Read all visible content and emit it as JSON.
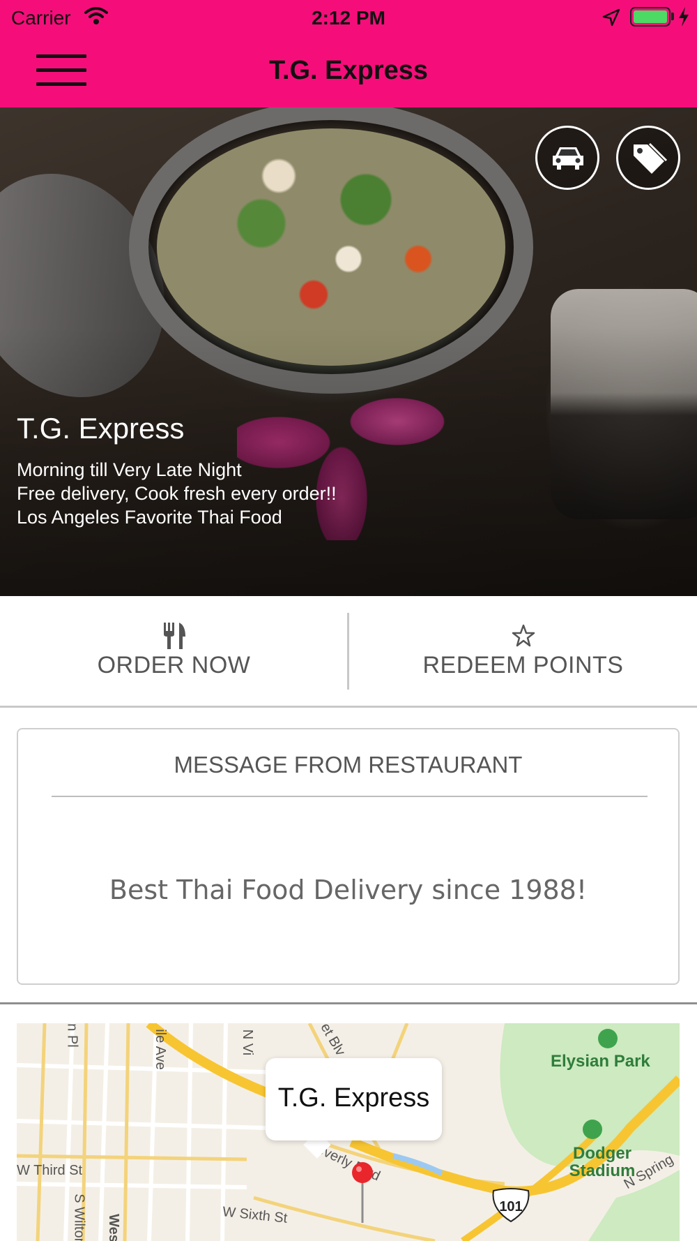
{
  "status_bar": {
    "carrier": "Carrier",
    "time": "2:12 PM"
  },
  "nav": {
    "title": "T.G. Express"
  },
  "hero": {
    "title": "T.G. Express",
    "lines": [
      "Morning till Very Late Night",
      "Free delivery, Cook fresh every order!!",
      "Los Angeles Favorite Thai Food"
    ]
  },
  "actions": {
    "order_label": "ORDER NOW",
    "redeem_label": "REDEEM POINTS"
  },
  "message": {
    "heading": "MESSAGE FROM RESTAURANT",
    "body": "Best Thai Food Delivery since 1988!"
  },
  "map": {
    "callout": "T.G. Express",
    "highway": "101",
    "park_labels": [
      "Elysian Park",
      "Dodger Stadium"
    ],
    "street_labels": [
      "W Third St",
      "W Sixth St",
      "Beverly Blvd",
      "N Spring",
      "S Wilton",
      "n Pl",
      "ile Ave",
      "N Vi",
      "et Blv",
      "Wes"
    ]
  },
  "colors": {
    "brand": "#f50e7a",
    "text_muted": "#555555"
  },
  "icons": [
    "menu-icon",
    "car-icon",
    "tag-icon",
    "utensils-icon",
    "star-icon",
    "map-pin-icon",
    "wifi-icon",
    "location-arrow-icon",
    "battery-icon"
  ]
}
